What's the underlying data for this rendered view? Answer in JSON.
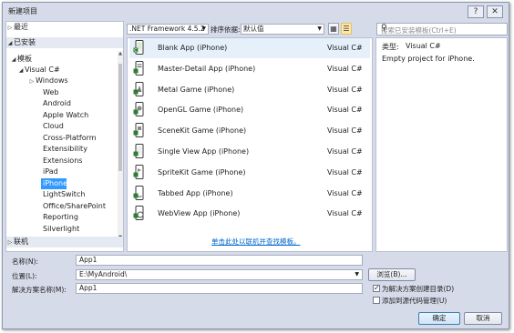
{
  "window": {
    "title": "新建项目",
    "help_btn": "?",
    "close_btn": "✕"
  },
  "left": {
    "recent": "最近",
    "installed": "已安装",
    "templates": "模板",
    "visual_csharp": "Visual C#",
    "items": [
      "Windows",
      "Web",
      "Android",
      "Apple Watch",
      "Cloud",
      "Cross-Platform",
      "Extensibility",
      "Extensions",
      "iPad",
      "iPhone",
      "LightSwitch",
      "Office/SharePoint",
      "Reporting",
      "Silverlight"
    ],
    "selected": "iPhone",
    "online": "联机"
  },
  "toolbar": {
    "framework": ".NET Framework 4.5.2",
    "sort_label": "排序依据:",
    "sort_value": "默认值"
  },
  "search": {
    "placeholder": "搜索已安装模板(Ctrl+E)"
  },
  "templates": [
    {
      "name": "Blank App (iPhone)",
      "lang": "Visual C#"
    },
    {
      "name": "Master-Detail App (iPhone)",
      "lang": "Visual C#"
    },
    {
      "name": "Metal Game (iPhone)",
      "lang": "Visual C#"
    },
    {
      "name": "OpenGL Game (iPhone)",
      "lang": "Visual C#"
    },
    {
      "name": "SceneKit Game (iPhone)",
      "lang": "Visual C#"
    },
    {
      "name": "Single View App (iPhone)",
      "lang": "Visual C#"
    },
    {
      "name": "SpriteKit Game (iPhone)",
      "lang": "Visual C#"
    },
    {
      "name": "Tabbed App (iPhone)",
      "lang": "Visual C#"
    },
    {
      "name": "WebView App (iPhone)",
      "lang": "Visual C#"
    }
  ],
  "online_link": "单击此处以联机并查找模板。",
  "details": {
    "type_label": "类型:",
    "type_value": "Visual C#",
    "description": "Empty project for iPhone."
  },
  "form": {
    "name_label": "名称(N):",
    "name_value": "App1",
    "location_label": "位置(L):",
    "location_value": "E:\\MyAndroid\\",
    "solution_label": "解决方案名称(M):",
    "solution_value": "App1",
    "browse": "浏览(B)...",
    "create_dir_label": "为解决方案创建目录(D)",
    "create_dir_checked": true,
    "source_control_label": "添加到源代码管理(U)",
    "source_control_checked": false,
    "ok": "确定",
    "cancel": "取消"
  }
}
